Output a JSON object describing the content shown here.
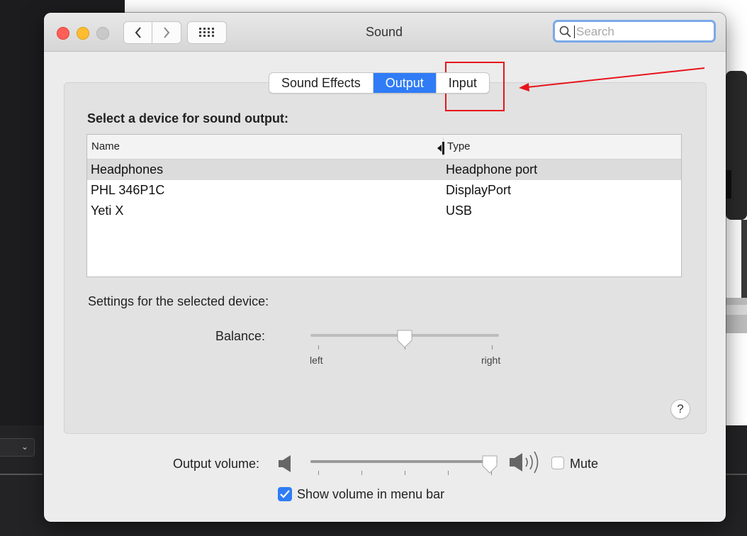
{
  "window": {
    "title": "Sound"
  },
  "search": {
    "placeholder": "Search"
  },
  "tabs": [
    {
      "label": "Sound Effects",
      "active": false
    },
    {
      "label": "Output",
      "active": true
    },
    {
      "label": "Input",
      "active": false
    }
  ],
  "output": {
    "section_title": "Select a device for sound output:",
    "columns": [
      "Name",
      "Type"
    ],
    "devices": [
      {
        "name": "Headphones",
        "type": "Headphone port",
        "selected": true
      },
      {
        "name": "PHL 346P1C",
        "type": "DisplayPort",
        "selected": false
      },
      {
        "name": "Yeti X",
        "type": "USB",
        "selected": false
      }
    ],
    "settings_label": "Settings for the selected device:",
    "balance": {
      "label": "Balance:",
      "left_label": "left",
      "right_label": "right",
      "value": 0.5
    }
  },
  "footer": {
    "volume_label": "Output volume:",
    "volume_value": 0.96,
    "mute_label": "Mute",
    "mute_checked": false,
    "show_volume_label": "Show volume in menu bar",
    "show_volume_checked": true
  },
  "help": {
    "symbol": "?"
  },
  "annotation": {
    "color": "#e8141c",
    "target": "Input"
  },
  "colors": {
    "accent": "#2f7cf6",
    "close": "#fe5f57",
    "minimize": "#febc2e"
  }
}
